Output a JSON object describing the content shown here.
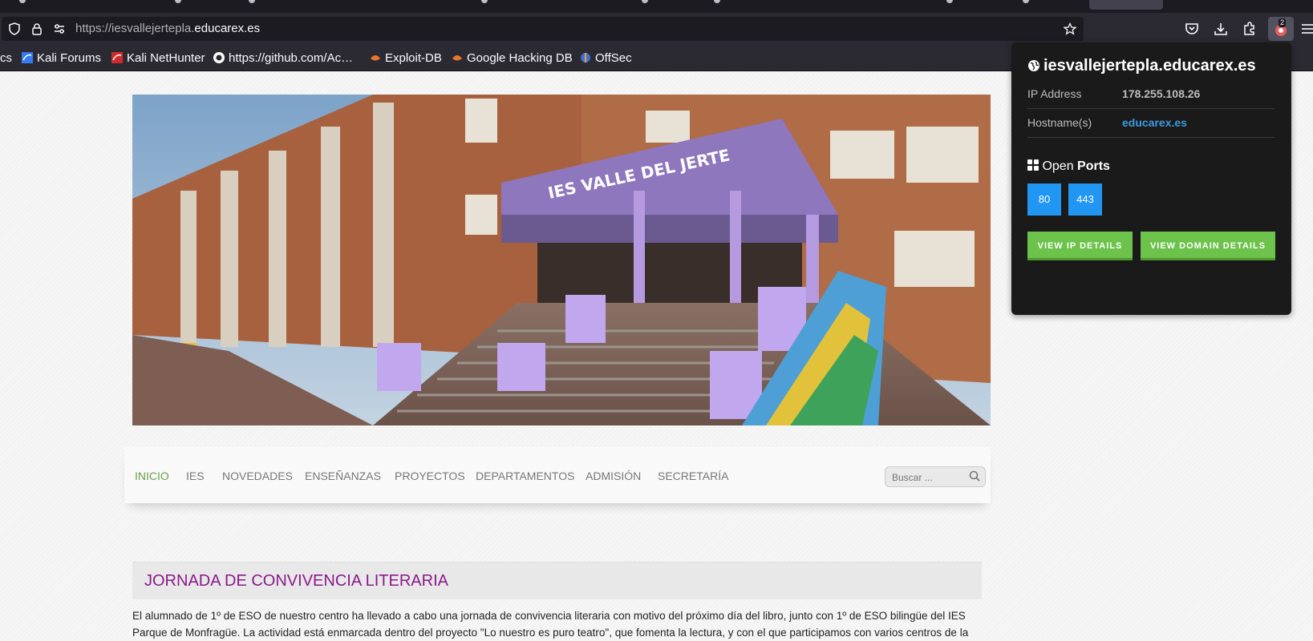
{
  "browser": {
    "url_prefix": "https://iesvallejertepla.",
    "url_domain": "educarex.es",
    "extension_badge": "2",
    "bookmarks": [
      {
        "label": "cs"
      },
      {
        "label": "Kali Forums"
      },
      {
        "label": "Kali NetHunter"
      },
      {
        "label": "https://github.com/Ac…"
      },
      {
        "label": "Exploit-DB"
      },
      {
        "label": "Google Hacking DB"
      },
      {
        "label": "OffSec"
      }
    ]
  },
  "site": {
    "hero_sign": "IES VALLE DEL JERTE",
    "nav": [
      {
        "label": "INICIO"
      },
      {
        "label": "IES"
      },
      {
        "label": "NOVEDADES"
      },
      {
        "label": "ENSEÑANZAS"
      },
      {
        "label": "PROYECTOS"
      },
      {
        "label": "DEPARTAMENTOS"
      },
      {
        "label": "ADMISIÓN"
      },
      {
        "label": "SECRETARÍA"
      }
    ],
    "search_placeholder": "Buscar ...",
    "post": {
      "title": "JORNADA DE CONVIVENCIA LITERARIA",
      "body": "El alumnado de 1º de ESO de nuestro centro ha llevado a cabo una jornada de convivencia literaria con motivo del próximo día del libro, junto con 1º de ESO bilingüe del IES Parque de Monfragüe. La actividad está enmarcada dentro del proyecto \"Lo nuestro es puro teatro\", que fomenta la lectura, y con el que participamos con varios centros de la"
    }
  },
  "popup": {
    "title": "iesvallejertepla.educarex.es",
    "ip_label": "IP Address",
    "ip_value": "178.255.108.26",
    "hostname_label": "Hostname(s)",
    "hostname_value": "educarex.es",
    "ports_title_a": "Open",
    "ports_title_b": "Ports",
    "ports": [
      "80",
      "443"
    ],
    "view_ip": "VIEW IP DETAILS",
    "view_domain": "VIEW DOMAIN DETAILS"
  }
}
